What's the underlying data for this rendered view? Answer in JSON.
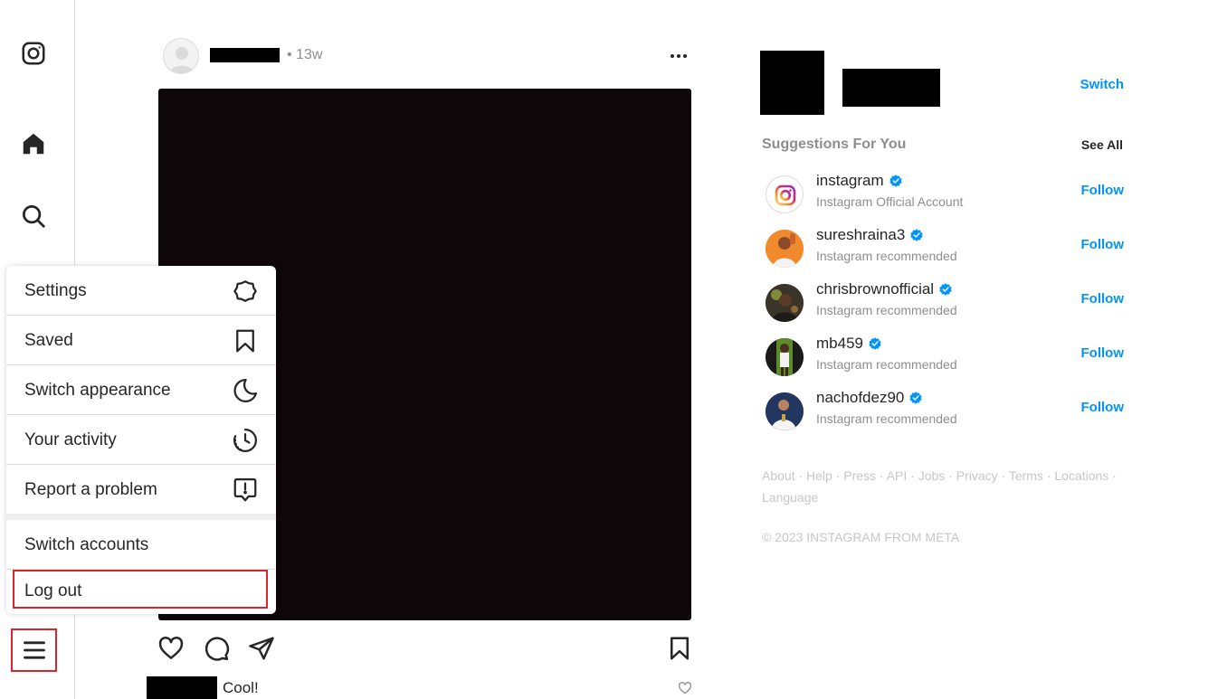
{
  "nav": {
    "icons": [
      "instagram-logo-icon",
      "home-icon",
      "search-icon",
      "menu-icon"
    ]
  },
  "post": {
    "time": "• 13w",
    "caption": "Cool!"
  },
  "menu": {
    "items": [
      {
        "label": "Settings",
        "icon": "settings-icon"
      },
      {
        "label": "Saved",
        "icon": "bookmark-icon"
      },
      {
        "label": "Switch appearance",
        "icon": "moon-icon"
      },
      {
        "label": "Your activity",
        "icon": "activity-clock-icon"
      },
      {
        "label": "Report a problem",
        "icon": "report-icon"
      }
    ],
    "switch_accounts": "Switch accounts",
    "log_out": "Log out",
    "highlight_color": "#d9232f"
  },
  "sidebar": {
    "switch": "Switch",
    "suggestions_title": "Suggestions For You",
    "see_all": "See All",
    "suggestions": [
      {
        "username": "instagram",
        "subtitle": "Instagram Official Account",
        "follow": "Follow"
      },
      {
        "username": "sureshraina3",
        "subtitle": "Instagram recommended",
        "follow": "Follow"
      },
      {
        "username": "chrisbrownofficial",
        "subtitle": "Instagram recommended",
        "follow": "Follow"
      },
      {
        "username": "mb459",
        "subtitle": "Instagram recommended",
        "follow": "Follow"
      },
      {
        "username": "nachofdez90",
        "subtitle": "Instagram recommended",
        "follow": "Follow"
      }
    ],
    "footer_links": "About · Help · Press · API · Jobs · Privacy · Terms · Locations · Language",
    "copyright": "© 2023 INSTAGRAM FROM META"
  },
  "colors": {
    "link_blue": "#0095f6",
    "verified_blue": "#0095f6",
    "muted": "#8e8e8e"
  }
}
